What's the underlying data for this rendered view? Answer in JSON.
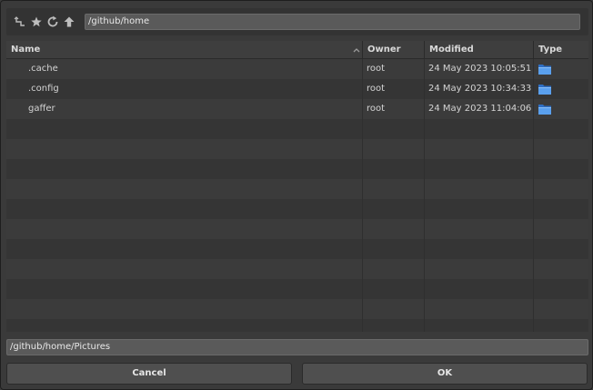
{
  "toolbar": {
    "icons": [
      "parent-directory-icon",
      "bookmark-star-icon",
      "refresh-icon",
      "up-arrow-icon"
    ],
    "path": "/github/home"
  },
  "table": {
    "columns": {
      "name": "Name",
      "owner": "Owner",
      "modified": "Modified",
      "type": "Type"
    },
    "sort_column": "name",
    "sort_direction": "ascending",
    "rows": [
      {
        "name": ".cache",
        "owner": "root",
        "modified": "24 May 2023 10:05:51",
        "type_icon": "folder-icon"
      },
      {
        "name": ".config",
        "owner": "root",
        "modified": "24 May 2023 10:34:33",
        "type_icon": "folder-icon"
      },
      {
        "name": "gaffer",
        "owner": "root",
        "modified": "24 May 2023 11:04:06",
        "type_icon": "folder-icon"
      }
    ]
  },
  "filename": "/github/home/Pictures",
  "buttons": {
    "cancel": "Cancel",
    "ok": "OK"
  },
  "colors": {
    "background": "#3a3a3a",
    "folder": "#3b7fd6"
  }
}
